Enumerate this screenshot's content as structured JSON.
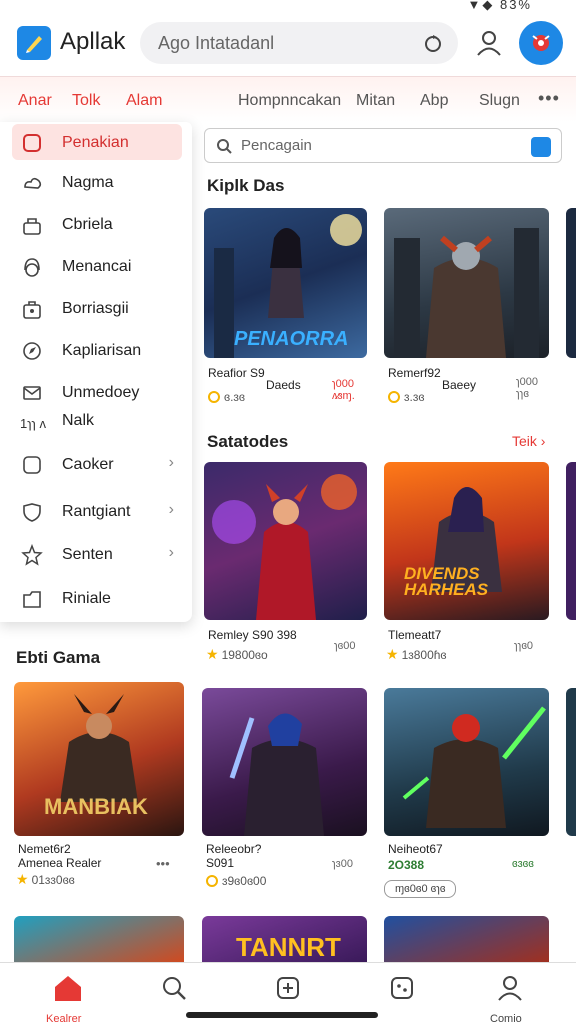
{
  "status_bar": {
    "indicators": "▼◆ 83%"
  },
  "header": {
    "app_name": "Apllak",
    "search_placeholder": "Ago Intatadanl",
    "icons": [
      "logo-icon",
      "refresh-icon",
      "user-icon",
      "alert-icon"
    ]
  },
  "nav": {
    "tabs": [
      "Anar",
      "Tolk",
      "Alam",
      "Hompnncakan",
      "Mitan",
      "Abp",
      "Slugn"
    ],
    "more": "•••"
  },
  "menu": {
    "items": [
      {
        "label": "Penakian",
        "icon": "square-icon",
        "active": true
      },
      {
        "label": "Nagma",
        "icon": "cloud-icon"
      },
      {
        "label": "Cbriela",
        "icon": "lock-icon"
      },
      {
        "label": "Menancai",
        "icon": "headset-icon"
      },
      {
        "label": "Borriasgii",
        "icon": "bag-icon"
      },
      {
        "label": "Kapliarisan",
        "icon": "compass-icon"
      },
      {
        "label": "Unmedoey",
        "icon": "mail-icon"
      },
      {
        "label": "Nalk",
        "icon": ""
      },
      {
        "label": "Caoker",
        "icon": "square-icon",
        "chevron": true
      },
      {
        "label": "Rantgiant",
        "icon": "shield-icon",
        "chevron": true
      },
      {
        "label": "Senten",
        "icon": "star-icon",
        "chevron": true
      },
      {
        "label": "Riniale",
        "icon": "folder-icon"
      }
    ],
    "sub_text": "1ɿɿ ʌ"
  },
  "content_search": {
    "placeholder": "Pencagain"
  },
  "sections": {
    "s1": {
      "title": "Kiplk Das"
    },
    "s2": {
      "title": "Satatodes",
      "see_all": "Teik ›"
    },
    "s3": {
      "title": "Ebti Gama"
    }
  },
  "cards": {
    "c1": {
      "art_title": "PENAORRA",
      "name": "Reafior S9",
      "sub": "Daeds",
      "meta": "ɞ.ɜɞ",
      "side": "ɿ000 ʌ̷ɜɱ."
    },
    "c2": {
      "name": "Remerf92",
      "sub": "Baeey",
      "meta": "ɜ.ɜɞ",
      "side": "ɿ000 ɿɿɞ"
    },
    "c3": {
      "name": "Remley S90 398",
      "meta": "19800ɞo",
      "side": "ɿɞ00"
    },
    "c4": {
      "art_title": "DIVENDS HARHEAS",
      "name": "Tlemeatt7",
      "meta": "1ɜ800ɦɞ",
      "side": "ɿɿɞ0"
    },
    "c5": {
      "art_title": "MANBIAK",
      "name": "Nemet6r2",
      "sub": "Amenea Realer",
      "meta": "01ɜɜ0ɞɞ",
      "side": "•••"
    },
    "c6": {
      "name": "Releeobr?",
      "sub": "S091",
      "meta": "ɜ9ɞ0ɞ00",
      "side": "ɿɜ00"
    },
    "c7": {
      "name": "Neiheot67",
      "sub": "2O388",
      "meta": "ɱɞ0ɞ0 ɞɿɞ",
      "side": "ɞɜɞɞ"
    },
    "c8": {
      "art_title": "TANNRT"
    }
  },
  "bottom_nav": {
    "items": [
      {
        "label": "Kealrer",
        "icon": "home-icon",
        "active": true
      },
      {
        "label": "",
        "icon": "search-icon"
      },
      {
        "label": "",
        "icon": "add-icon"
      },
      {
        "label": "",
        "icon": "games-icon"
      },
      {
        "label": "Comio",
        "icon": "profile-icon"
      }
    ]
  },
  "colors": {
    "accent_red": "#e53935",
    "accent_blue": "#1e88e5"
  }
}
